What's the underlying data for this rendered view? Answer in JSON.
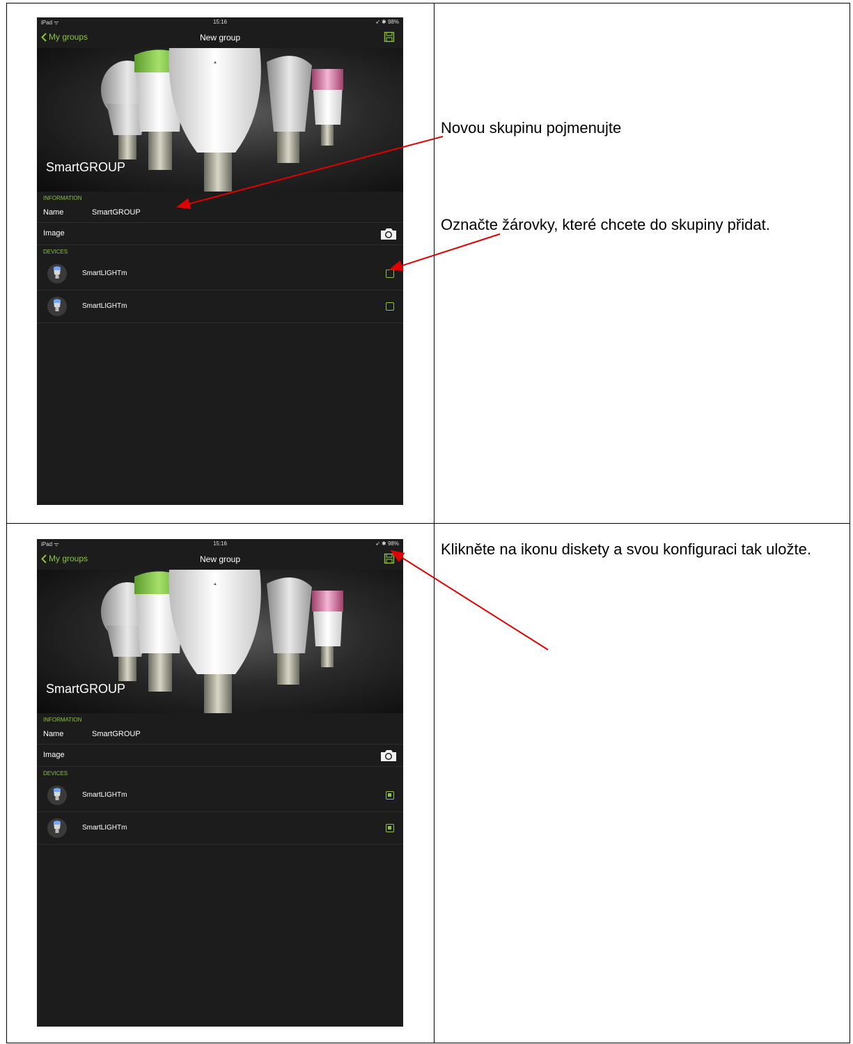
{
  "steps": [
    {
      "captions": [
        "Novou skupinu pojmenujte",
        "Označte žárovky, které chcete do skupiny přidat."
      ],
      "ipad": {
        "status": {
          "carrier": "iPad ᯤ",
          "time": "15:16",
          "battery": "➶ ✱ 98%"
        },
        "nav": {
          "back_label": "My groups",
          "title": "New group"
        },
        "hero_title": "SmartGROUP",
        "information_header": "INFORMATION",
        "name_label": "Name",
        "name_value": "SmartGROUP",
        "image_label": "Image",
        "devices_header": "DEVICES",
        "devices": [
          {
            "name": "SmartLIGHTm",
            "checked": false
          },
          {
            "name": "SmartLIGHTm",
            "checked": false
          }
        ]
      }
    },
    {
      "captions": [
        "Klikněte na ikonu diskety a svou konfiguraci tak uložte."
      ],
      "ipad": {
        "status": {
          "carrier": "iPad ᯤ",
          "time": "15:16",
          "battery": "➶ ✱ 98%"
        },
        "nav": {
          "back_label": "My groups",
          "title": "New group"
        },
        "hero_title": "SmartGROUP",
        "information_header": "INFORMATION",
        "name_label": "Name",
        "name_value": "SmartGROUP",
        "image_label": "Image",
        "devices_header": "DEVICES",
        "devices": [
          {
            "name": "SmartLIGHTm",
            "checked": true
          },
          {
            "name": "SmartLIGHTm",
            "checked": true
          }
        ]
      }
    }
  ],
  "colors": {
    "accent": "#8cc63f",
    "annotation": "#e00000"
  }
}
